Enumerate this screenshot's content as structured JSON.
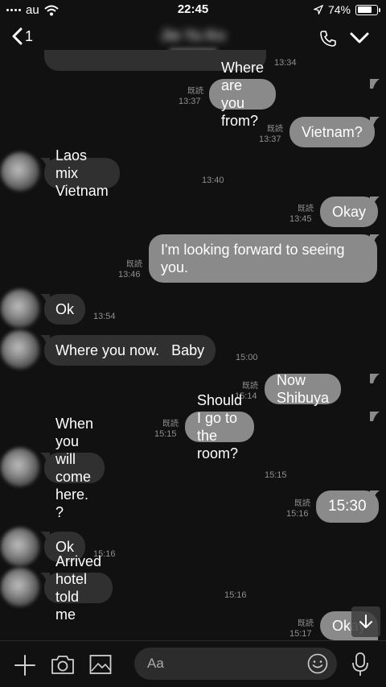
{
  "status": {
    "carrier": "au",
    "time": "22:45",
    "battery_pct": "74%",
    "battery_level": 0.74
  },
  "header": {
    "back_count": "1",
    "contact_name": "Jie Yu Ko",
    "contact_sub": "· · ·"
  },
  "messages": [
    {
      "dir": "in",
      "text": "",
      "time": "13:34"
    },
    {
      "dir": "out",
      "text": "Where are you from?",
      "read": "既読",
      "time": "13:37"
    },
    {
      "dir": "out",
      "text": "Vietnam?",
      "read": "既読",
      "time": "13:37"
    },
    {
      "dir": "in",
      "text": "Laos mix Vietnam",
      "time": "13:40"
    },
    {
      "dir": "out",
      "text": "Okay",
      "read": "既読",
      "time": "13:45"
    },
    {
      "dir": "out",
      "text": "I'm looking forward to seeing you.",
      "line1": "I'm looking forward to seeing",
      "line2": "you.",
      "read": "既読",
      "time": "13:46"
    },
    {
      "dir": "in",
      "text": "Ok",
      "time": "13:54"
    },
    {
      "dir": "in",
      "text": "Where you now.   Baby",
      "time": "15:00"
    },
    {
      "dir": "out",
      "text": "Now Shibuya",
      "read": "既読",
      "time": "15:14"
    },
    {
      "dir": "out",
      "text": "Should I go to the room?",
      "read": "既読",
      "time": "15:15"
    },
    {
      "dir": "in",
      "text": "When you will come here. ?",
      "time": "15:15"
    },
    {
      "dir": "out",
      "text": "15:30",
      "read": "既読",
      "time": "15:16"
    },
    {
      "dir": "in",
      "text": "Ok",
      "time": "15:16"
    },
    {
      "dir": "in",
      "text": "Arrived hotel told me",
      "time": "15:16"
    },
    {
      "dir": "out",
      "text": "Okay",
      "read": "既読",
      "time": "15:17"
    }
  ],
  "composer": {
    "placeholder": "Aa"
  },
  "icons": {
    "back": "chevron-left-icon",
    "call": "phone-icon",
    "menu": "chevron-down-icon",
    "add": "plus-icon",
    "camera": "camera-icon",
    "image": "image-icon",
    "emoji": "emoji-icon",
    "mic": "microphone-icon",
    "scroll": "arrow-down-icon"
  },
  "colors": {
    "background": "#111111",
    "bubble_out": "#8a8a8a",
    "bubble_in": "#303030",
    "meta_text": "#8f8f8f"
  }
}
